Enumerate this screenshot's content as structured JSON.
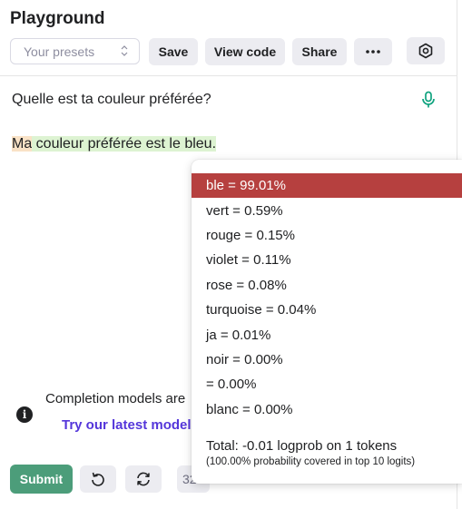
{
  "header": {
    "title": "Playground",
    "preset_placeholder": "Your presets",
    "save_label": "Save",
    "view_code_label": "View code",
    "share_label": "Share",
    "more_label": "•••"
  },
  "editor": {
    "prompt": "Quelle est ta couleur préférée?",
    "completion_tokens": [
      "Ma",
      " couleur préférée est le bleu."
    ]
  },
  "notice": {
    "text": "Completion models are",
    "link": "Try our latest model"
  },
  "footer": {
    "submit_label": "Submit",
    "token_count": "32"
  },
  "logprobs": {
    "options": [
      {
        "label": "ble = 99.01%",
        "selected": true
      },
      {
        "label": "vert = 0.59%",
        "selected": false
      },
      {
        "label": "rouge = 0.15%",
        "selected": false
      },
      {
        "label": "violet = 0.11%",
        "selected": false
      },
      {
        "label": "rose = 0.08%",
        "selected": false
      },
      {
        "label": "turquoise = 0.04%",
        "selected": false
      },
      {
        "label": "ja = 0.01%",
        "selected": false
      },
      {
        "label": "noir = 0.00%",
        "selected": false
      },
      {
        "label": " = 0.00%",
        "selected": false
      },
      {
        "label": "blanc = 0.00%",
        "selected": false
      }
    ],
    "total": "Total: -0.01 logprob on 1 tokens",
    "covered": "(100.00% probability covered in top 10 logits)"
  },
  "colors": {
    "selected": "#b6403f",
    "submit": "#4c9d7a",
    "link": "#5436da",
    "mic": "#10a37f"
  },
  "icons": [
    "chevron-updown-icon",
    "more-icon",
    "settings-icon",
    "mic-icon",
    "info-icon",
    "undo-icon",
    "regenerate-icon"
  ]
}
